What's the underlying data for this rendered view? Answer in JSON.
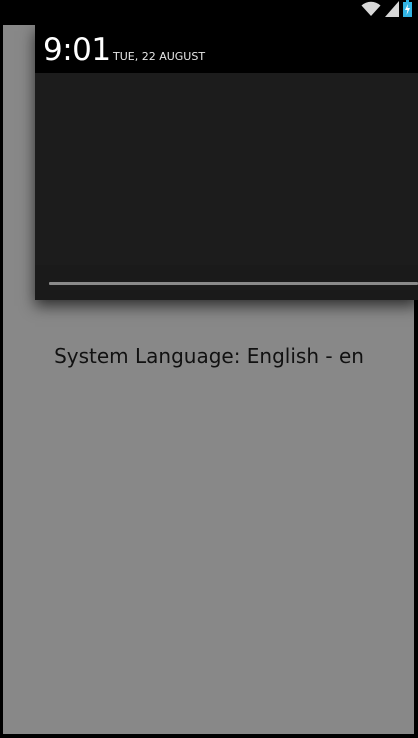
{
  "status_bar": {
    "icons": [
      "wifi-icon",
      "signal-icon",
      "battery-charging-icon"
    ],
    "colors": {
      "icon": "#d9d9d9",
      "battery": "#33b5e5"
    }
  },
  "notification_shade": {
    "time": "9:01",
    "date": "TUE, 22 AUGUST"
  },
  "app": {
    "message": "System Language: English - en"
  },
  "colors": {
    "screen_background": "#888888",
    "shade_background": "#1c1c1c",
    "header_background": "#000000"
  }
}
